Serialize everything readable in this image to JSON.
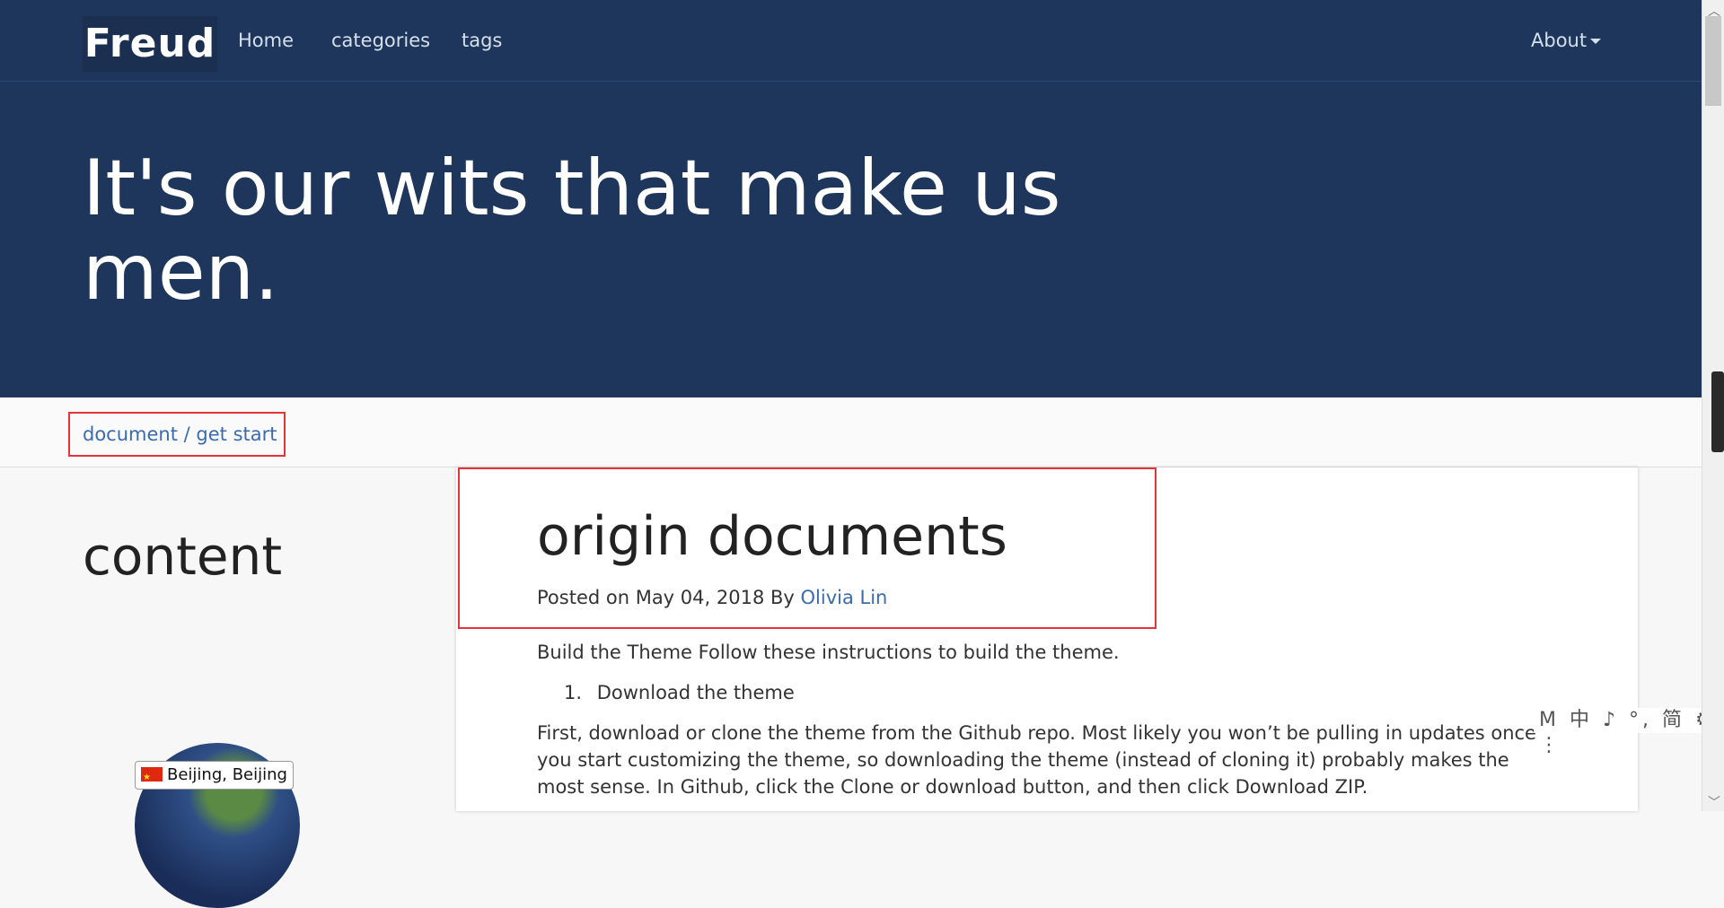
{
  "nav": {
    "brand": "Freud",
    "links": [
      "Home",
      "categories",
      "tags"
    ],
    "about": "About"
  },
  "hero": {
    "title": "It's our wits that make us men."
  },
  "breadcrumb": {
    "parent": "document",
    "separator": " / ",
    "current": "get start"
  },
  "sidebar": {
    "title": "content",
    "globe_label": "Beijing, Beijing",
    "globe_flag_icon": "china-flag-icon"
  },
  "post": {
    "title": "origin documents",
    "meta_prefix": "Posted on May 04, 2018 By ",
    "author": "Olivia Lin",
    "intro": "Build the Theme Follow these instructions to build the theme.",
    "list_number": "1.",
    "list_item": "Download the theme",
    "paragraph": "First, download or clone the theme from the Github repo. Most likely you won’t be pulling in updates once you start customizing the theme, so downloading the theme (instead of cloning it) probably makes the most sense. In Github, click the Clone or download button, and then click Download ZIP."
  },
  "ime": {
    "text": "M 中 ♪ °, 简 ⚙ ⋮"
  },
  "colors": {
    "navy": "#1f365c",
    "link_blue": "#3a6bb0",
    "highlight_red": "#e3343a"
  }
}
